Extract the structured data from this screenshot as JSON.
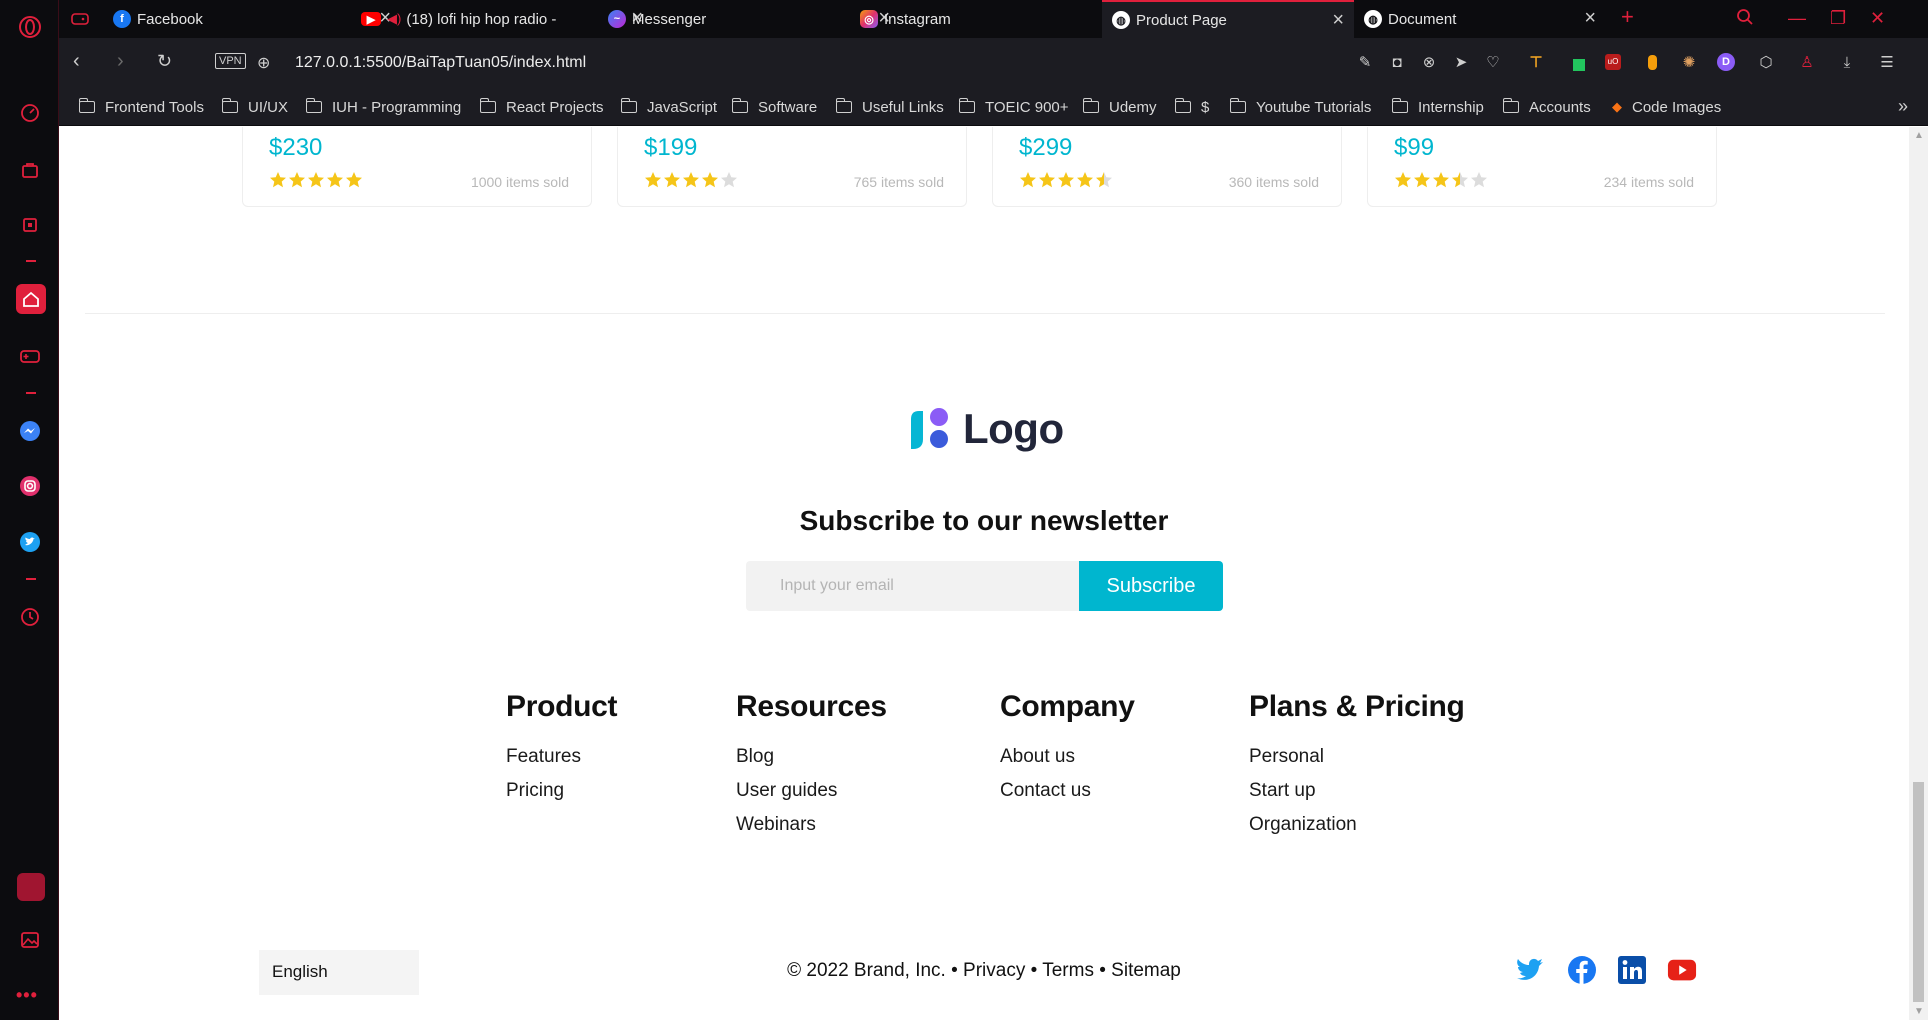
{
  "browser": {
    "tabs": [
      {
        "title": "Facebook",
        "icon": "facebook-icon",
        "color": "#1877f2"
      },
      {
        "title": "(18) lofi hip hop radio -",
        "icon": "youtube-icon",
        "color": "#ff0000"
      },
      {
        "title": "Messenger",
        "icon": "messenger-icon",
        "color": "#8a5cf6"
      },
      {
        "title": "Instagram",
        "icon": "instagram-icon",
        "color": "#e1306c"
      },
      {
        "title": "Product Page",
        "icon": "globe-icon",
        "color": "#ffffff"
      },
      {
        "title": "Document",
        "icon": "globe-icon",
        "color": "#ffffff"
      }
    ],
    "url": "127.0.0.1:5500/BaiTapTuan05/index.html",
    "vpn_label": "VPN",
    "bookmarks": [
      "Frontend Tools",
      "UI/UX",
      "IUH - Programming",
      "React Projects",
      "JavaScript",
      "Software",
      "Useful Links",
      "TOEIC 900+",
      "Udemy",
      "$",
      "Youtube Tutorials",
      "Internship",
      "Accounts",
      "Code Images"
    ],
    "accent": "#e0203c"
  },
  "products": [
    {
      "price": "$230",
      "rating": 5,
      "sold": "1000 items sold"
    },
    {
      "price": "$199",
      "rating": 4,
      "sold": "765 items sold"
    },
    {
      "price": "$299",
      "rating": 4.5,
      "sold": "360 items sold"
    },
    {
      "price": "$99",
      "rating": 3.5,
      "sold": "234 items sold"
    }
  ],
  "footer": {
    "logo_text": "Logo",
    "newsletter_title": "Subscribe to our newsletter",
    "email_placeholder": "Input your email",
    "subscribe_label": "Subscribe",
    "columns": [
      {
        "title": "Product",
        "links": [
          "Features",
          "Pricing"
        ]
      },
      {
        "title": "Resources",
        "links": [
          "Blog",
          "User guides",
          "Webinars"
        ]
      },
      {
        "title": "Company",
        "links": [
          "About us",
          "Contact us"
        ]
      },
      {
        "title": "Plans & Pricing",
        "links": [
          "Personal",
          "Start up",
          "Organization"
        ]
      }
    ],
    "language": "English",
    "copyright": "© 2022 Brand, Inc.",
    "legal_links": [
      "Privacy",
      "Terms",
      "Sitemap"
    ],
    "socials": [
      "twitter-icon",
      "facebook-icon",
      "linkedin-icon",
      "youtube-icon"
    ],
    "brand_color": "#00b6cf",
    "star_color": "#f5c518"
  }
}
